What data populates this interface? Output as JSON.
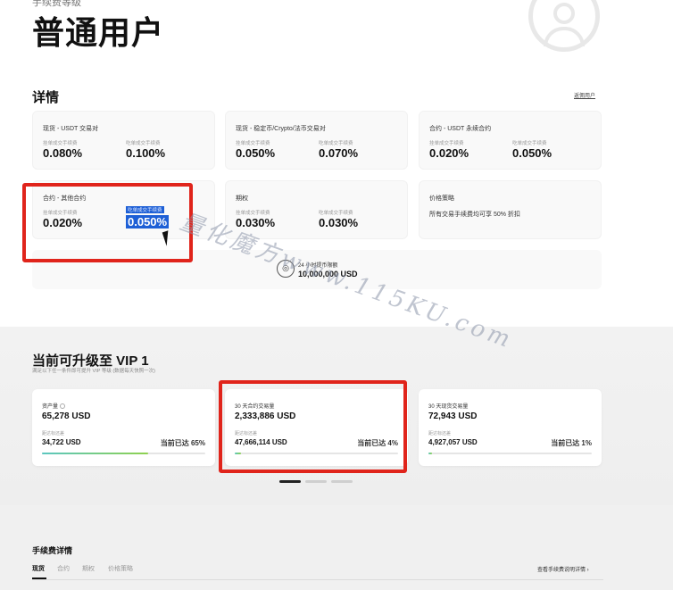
{
  "header": {
    "subtitle": "手续费等级",
    "title": "普通用户"
  },
  "details": {
    "title": "详情",
    "link": "返佣用户"
  },
  "fee_cards": [
    {
      "title": "现货 - USDT 交易对",
      "maker_label": "挂单成交手续费",
      "maker": "0.080%",
      "taker_label": "吃单成交手续费",
      "taker": "0.100%"
    },
    {
      "title": "现货 - 稳定币/Crypto/法币交易对",
      "maker_label": "挂单成交手续费",
      "maker": "0.050%",
      "taker_label": "吃单成交手续费",
      "taker": "0.070%"
    },
    {
      "title": "合约 - USDT 永续合约",
      "maker_label": "挂单成交手续费",
      "maker": "0.020%",
      "taker_label": "吃单成交手续费",
      "taker": "0.050%"
    },
    {
      "title": "合约 - 其他合约",
      "maker_label": "挂单成交手续费",
      "maker": "0.020%",
      "taker_label": "吃单成交手续费",
      "taker": "0.050%"
    },
    {
      "title": "期权",
      "maker_label": "挂单成交手续费",
      "maker": "0.030%",
      "taker_label": "吃单成交手续费",
      "taker": "0.030%"
    }
  ],
  "discount_card": {
    "title": "价格策略",
    "text": "所有交易手续费均可享 50% 折扣"
  },
  "volume": {
    "icon": "coin-stack-icon",
    "label": "24 小时提币限额",
    "value": "10,000,000 USD"
  },
  "watermark": "量化魔方www.115KU.com",
  "upgrade": {
    "title": "当前可升级至 VIP 1",
    "subtitle": "满足以下任一条件即可提升 VIP 等级 (数据每天快照一次)",
    "cards": [
      {
        "label": "资产量",
        "value": "65,278 USD",
        "target_label": "距达标还差",
        "target": "34,722 USD",
        "reached": "当前已达 65%",
        "progress": 0.65
      },
      {
        "label": "30 天合约交易量",
        "value": "2,333,886 USD",
        "target_label": "距达标还差",
        "target": "47,666,114 USD",
        "reached": "当前已达 4%",
        "progress": 0.04
      },
      {
        "label": "30 天现货交易量",
        "value": "72,943 USD",
        "target_label": "距达标还差",
        "target": "4,927,057 USD",
        "reached": "当前已达 1%",
        "progress": 0.01
      }
    ]
  },
  "fee_details": {
    "title": "手续费详情",
    "tabs": [
      "现货",
      "合约",
      "期权",
      "价格策略"
    ],
    "link": "查看手续费说明详情 ›"
  },
  "colors": {
    "highlight": "#1d5fd6",
    "annotation_red": "#e0241b",
    "progress_start": "#5cc7c0",
    "progress_end": "#8fd14f"
  }
}
